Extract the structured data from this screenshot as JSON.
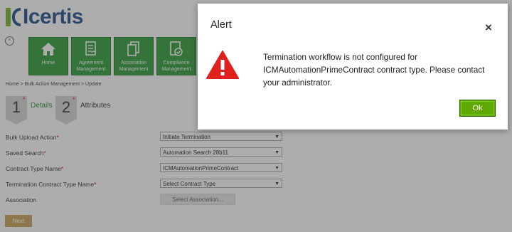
{
  "app": {
    "logo_text": "Icertis"
  },
  "nav": {
    "tiles": [
      {
        "label": "Home",
        "icon": "home-icon"
      },
      {
        "label": "Agreement Management",
        "icon": "agreement-doc-icon"
      },
      {
        "label": "Association Management",
        "icon": "association-doc-icon"
      },
      {
        "label": "Compliance Management",
        "icon": "compliance-check-icon"
      }
    ]
  },
  "breadcrumb": "Home > Bulk Action Management > Update",
  "steps": [
    {
      "number": "1",
      "label": "Details"
    },
    {
      "number": "2",
      "label": "Attributes"
    }
  ],
  "form": {
    "bulk_upload_action": {
      "label": "Bulk Upload Action",
      "value": "Initiate Termination"
    },
    "saved_search": {
      "label": "Saved Search",
      "value": "Automation Search 28b11"
    },
    "contract_type_name": {
      "label": "Contract Type Name",
      "value": "ICMAutomationPrimeContract"
    },
    "termination_contract_type_name": {
      "label": "Termination Contract Type Name",
      "value": "Select Contract Type"
    },
    "association": {
      "label": "Association",
      "button": "Select Association..."
    },
    "required_mark": "*",
    "next_label": "Next"
  },
  "alert": {
    "title": "Alert",
    "close_glyph": "×",
    "message": "Termination workflow is not configured for ICMAutomationPrimeContract contract type. Please contact your administrator.",
    "ok_label": "Ok",
    "icon": "warning-triangle-icon"
  },
  "colors": {
    "tile_green": "#2f9b3a",
    "ok_green": "#5ea800",
    "warning_red": "#e0201c",
    "brand_blue": "#1f4e8a"
  }
}
